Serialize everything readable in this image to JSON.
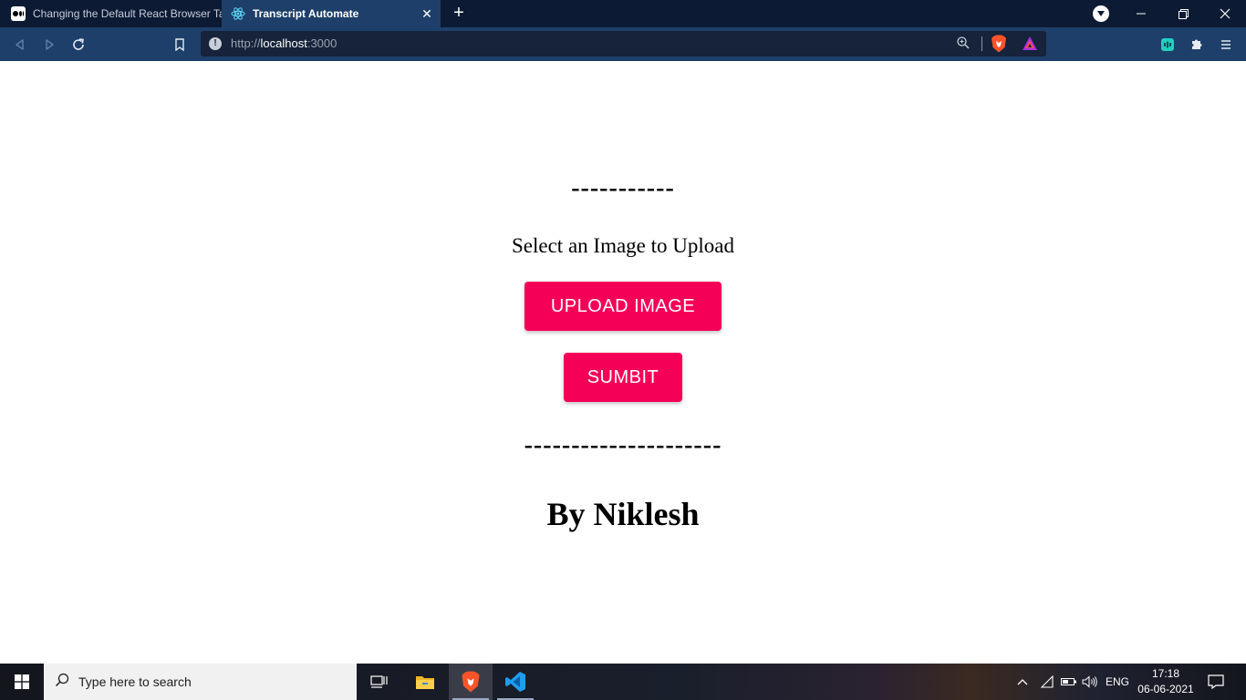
{
  "browser": {
    "tabs": [
      {
        "title": "Changing the Default React Browser Ta",
        "active": false
      },
      {
        "title": "Transcript Automate",
        "active": true
      }
    ],
    "address": {
      "scheme": "http://",
      "host": "localhost",
      "port": ":3000"
    }
  },
  "page": {
    "divider_top": "-----------",
    "prompt": "Select an Image to Upload",
    "upload_label": "UPLOAD IMAGE",
    "submit_label": "SUMBIT",
    "divider_bottom": "---------------------",
    "byline": "By Niklesh"
  },
  "taskbar": {
    "search_placeholder": "Type here to search",
    "language": "ENG",
    "time": "17:18",
    "date": "06-06-2021"
  },
  "colors": {
    "accent_button": "#f50057",
    "toolbar": "#1d3f6a",
    "tabstrip": "#0c1a33"
  }
}
